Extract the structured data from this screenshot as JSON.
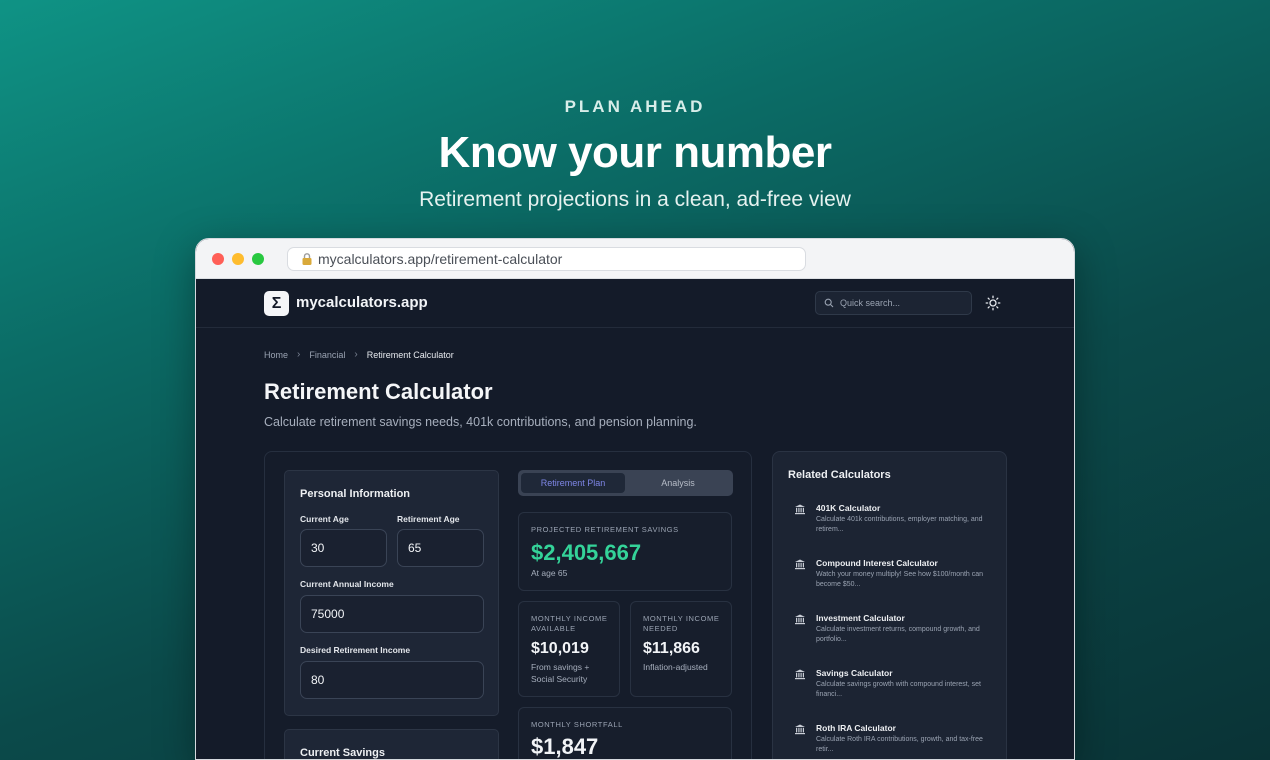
{
  "hero": {
    "eyebrow": "PLAN AHEAD",
    "title": "Know your number",
    "subtitle": "Retirement projections in a clean, ad-free view"
  },
  "browser": {
    "url": "mycalculators.app/retirement-calculator"
  },
  "nav": {
    "logo_glyph": "Σ",
    "site_name": "mycalculators.app",
    "search_placeholder": "Quick search..."
  },
  "breadcrumb": [
    "Home",
    "Financial",
    "Retirement Calculator"
  ],
  "page": {
    "title": "Retirement Calculator",
    "description": "Calculate retirement savings needs, 401k contributions, and pension planning."
  },
  "personal_info": {
    "title": "Personal Information",
    "current_age_label": "Current Age",
    "current_age": "30",
    "retirement_age_label": "Retirement Age",
    "retirement_age": "65",
    "income_label": "Current Annual Income",
    "income": "75000",
    "desired_label": "Desired Retirement Income",
    "desired": "80"
  },
  "current_savings": {
    "title": "Current Savings"
  },
  "tabs": [
    {
      "label": "Retirement Plan",
      "active": true
    },
    {
      "label": "Analysis",
      "active": false
    }
  ],
  "results": {
    "projected": {
      "label": "PROJECTED RETIREMENT SAVINGS",
      "value": "$2,405,667",
      "note": "At age 65",
      "color": "#34d399"
    },
    "available": {
      "label_line1": "MONTHLY INCOME",
      "label_line2": "AVAILABLE",
      "value": "$10,019",
      "note_line1": "From savings +",
      "note_line2": "Social Security"
    },
    "needed": {
      "label_line1": "MONTHLY INCOME",
      "label_line2": "NEEDED",
      "value": "$11,866",
      "note": "Inflation-adjusted"
    },
    "shortfall": {
      "label": "MONTHLY SHORTFALL",
      "value": "$1,847"
    }
  },
  "related": {
    "title": "Related Calculators",
    "items": [
      {
        "name": "401K Calculator",
        "desc": "Calculate 401k contributions, employer matching, and retirem...",
        "icon": "bank-icon"
      },
      {
        "name": "Compound Interest Calculator",
        "desc": "Watch your money multiply! See how $100/month can become $50...",
        "icon": "bank-icon"
      },
      {
        "name": "Investment Calculator",
        "desc": "Calculate investment returns, compound growth, and portfolio...",
        "icon": "bank-icon"
      },
      {
        "name": "Savings Calculator",
        "desc": "Calculate savings growth with compound interest, set financi...",
        "icon": "bank-icon"
      },
      {
        "name": "Roth IRA Calculator",
        "desc": "Calculate Roth IRA contributions, growth, and tax-free retir...",
        "icon": "bank-icon"
      }
    ]
  }
}
